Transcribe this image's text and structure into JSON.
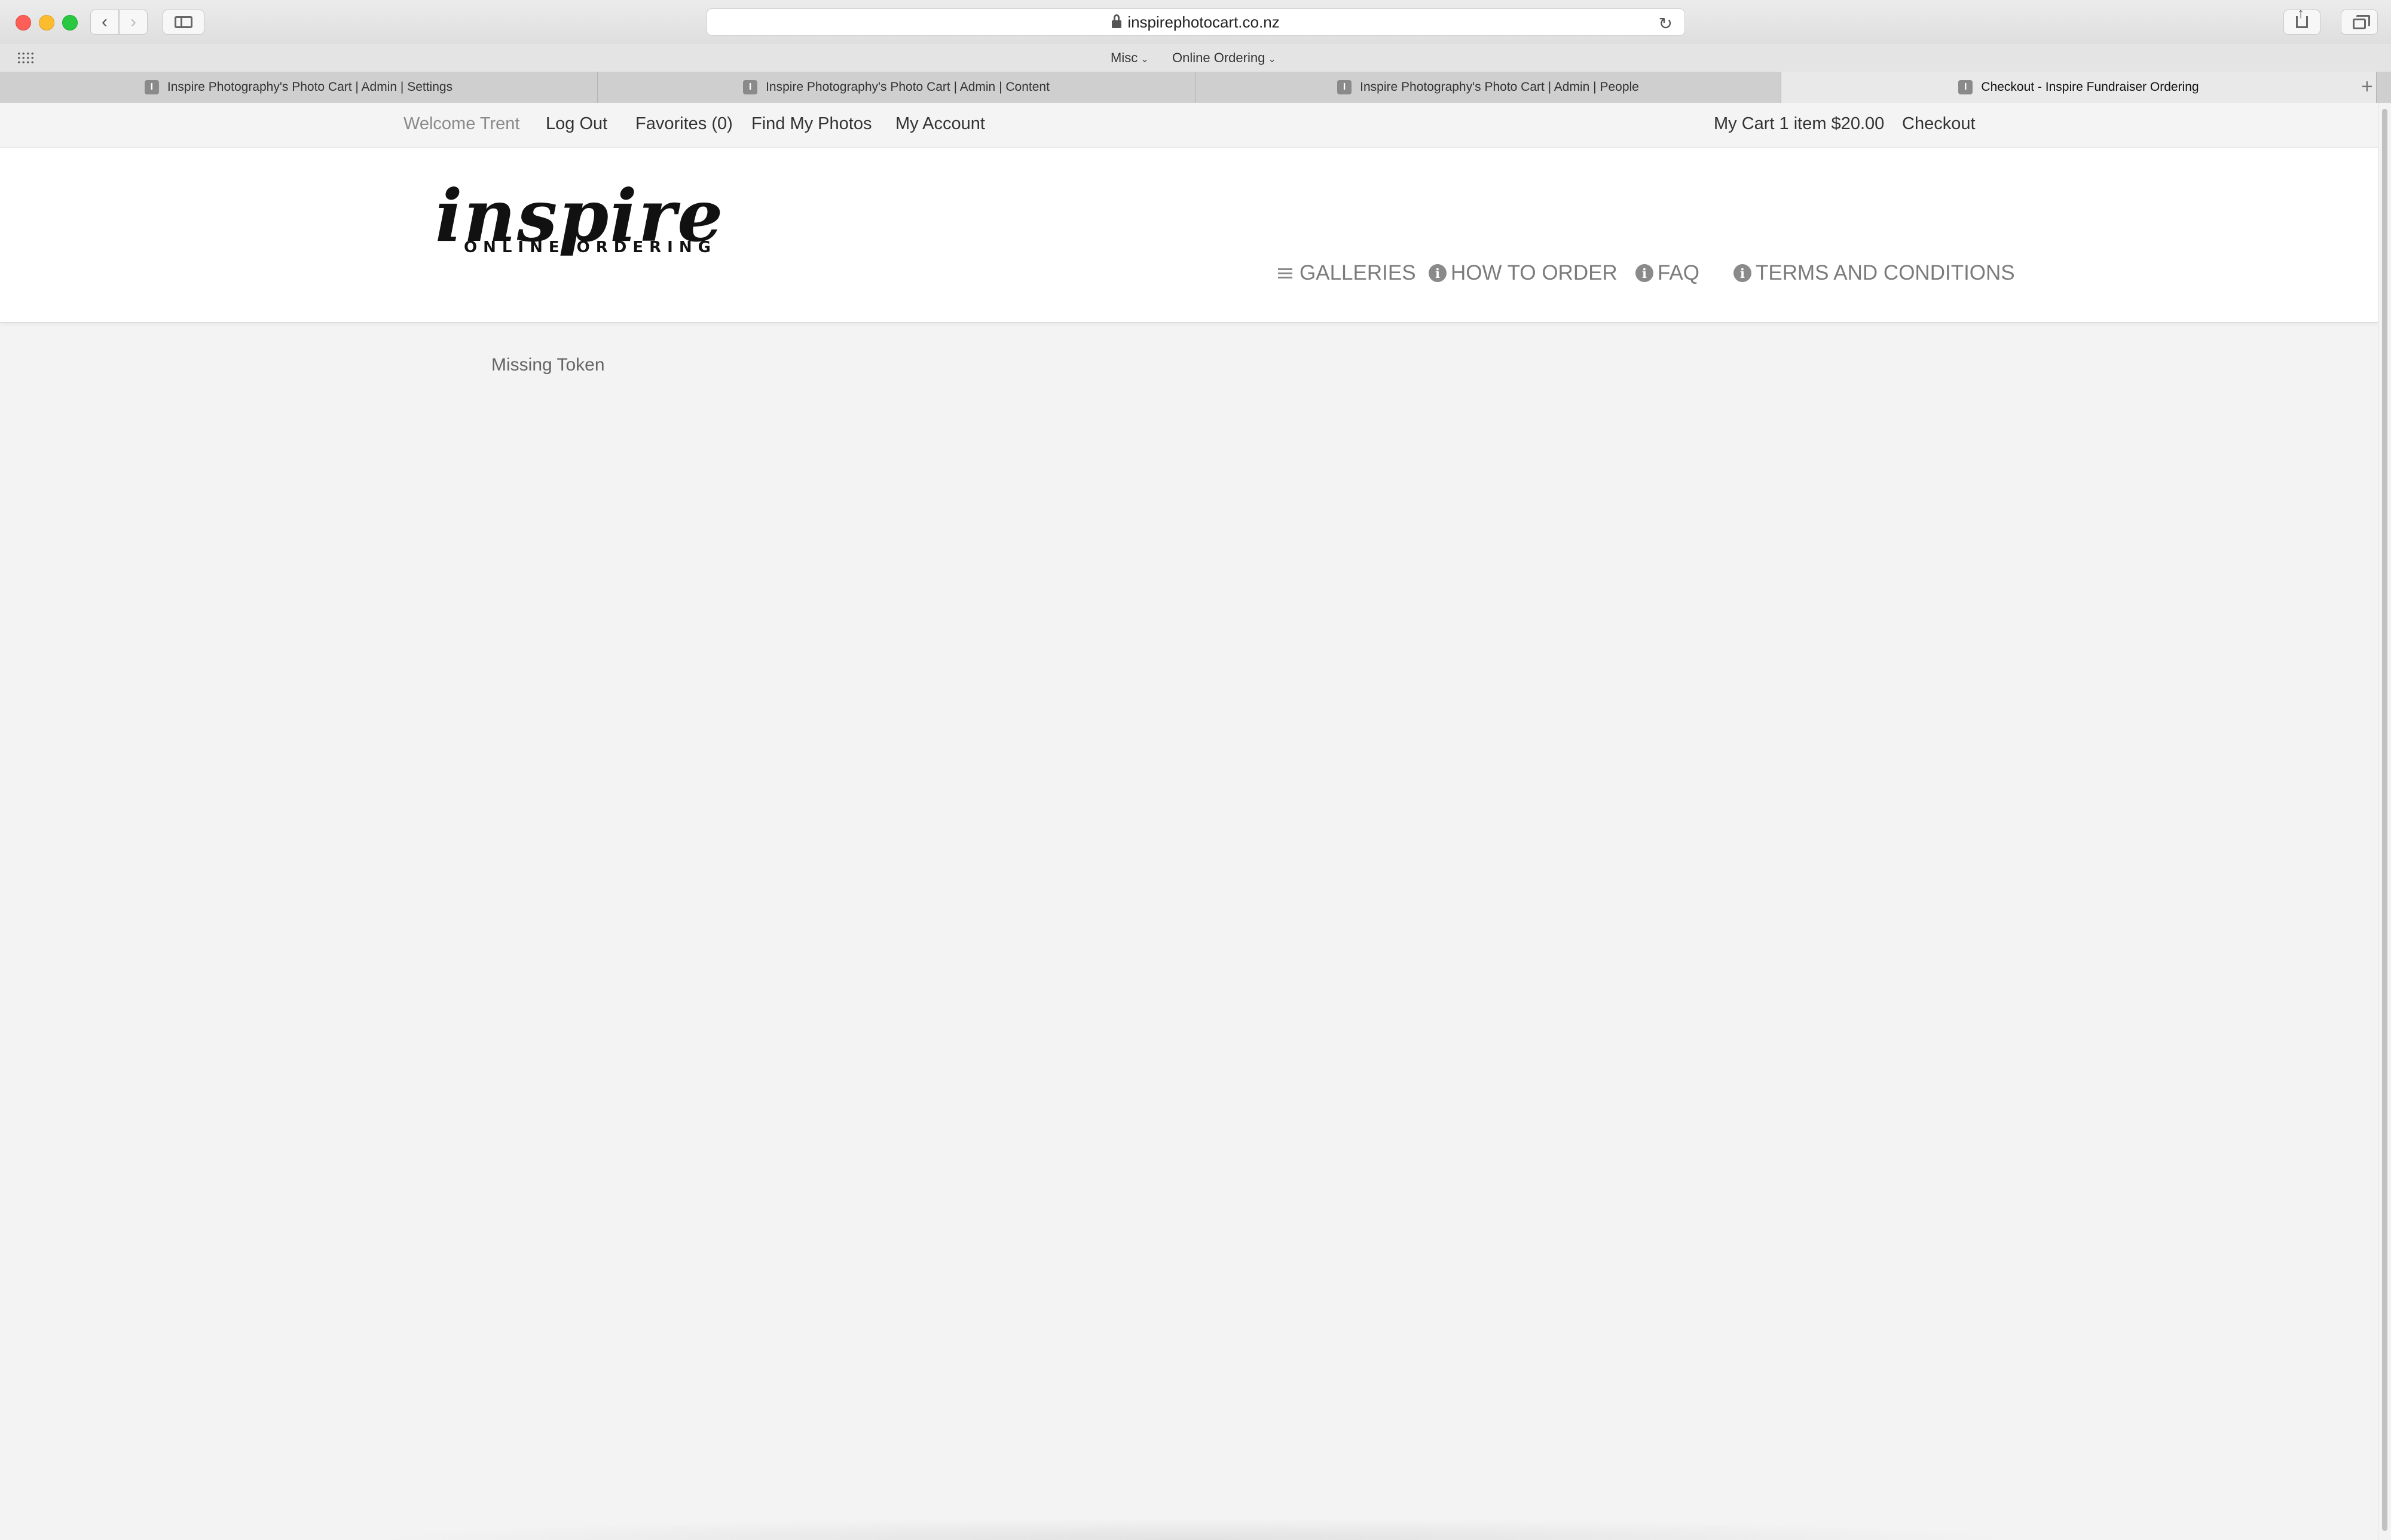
{
  "browser": {
    "address": "inspirephotocart.co.nz",
    "bookmarks": [
      {
        "label": "Misc"
      },
      {
        "label": "Online Ordering"
      }
    ],
    "tabs": [
      {
        "title": "Inspire Photography's Photo Cart | Admin | Settings",
        "favicon": "I"
      },
      {
        "title": "Inspire Photography's Photo Cart | Admin | Content",
        "favicon": "I"
      },
      {
        "title": "Inspire Photography's Photo Cart | Admin | People",
        "favicon": "I"
      },
      {
        "title": "Checkout - Inspire Fundraiser Ordering",
        "favicon": "I",
        "active": true
      }
    ]
  },
  "topnav": {
    "welcome": "Welcome Trent",
    "logout": "Log Out",
    "favorites": "Favorites (0)",
    "find_photos": "Find My Photos",
    "account": "My Account",
    "cart": "My Cart 1 item $20.00",
    "checkout": "Checkout"
  },
  "logo": {
    "script": "inspire",
    "subtitle": "ONLINE ORDERING"
  },
  "menu": {
    "galleries": "GALLERIES",
    "how_to_order": "HOW TO ORDER",
    "faq": "FAQ",
    "terms": "TERMS AND CONDITIONS",
    "info_glyph": "i"
  },
  "content": {
    "message": "Missing Token"
  },
  "colors": {
    "page_bg": "#f3f3f3",
    "menu_text": "#7b7b7b",
    "nav_text": "#333333"
  }
}
